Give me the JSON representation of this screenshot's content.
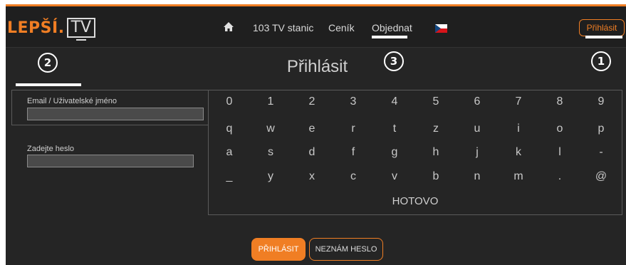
{
  "brand": {
    "logo_part1": "LEPŠÍ.",
    "logo_part2": "TV",
    "accent_color": "#f07e24"
  },
  "nav": {
    "home_icon": "home-icon",
    "items": [
      {
        "label": "103 TV stanic"
      },
      {
        "label": "Ceník"
      },
      {
        "label": "Objednat"
      }
    ],
    "language_flag": "czech-flag-icon",
    "login_label": "Přihlásit"
  },
  "page": {
    "title": "Přihlásit"
  },
  "form": {
    "email_label": "Email / Uživatelské jméno",
    "email_value": "",
    "password_label": "Zadejte heslo",
    "password_value": ""
  },
  "keyboard": {
    "rows": [
      [
        "0",
        "1",
        "2",
        "3",
        "4",
        "5",
        "6",
        "7",
        "8",
        "9"
      ],
      [
        "q",
        "w",
        "e",
        "r",
        "t",
        "z",
        "u",
        "i",
        "o",
        "p"
      ],
      [
        "a",
        "s",
        "d",
        "f",
        "g",
        "h",
        "j",
        "k",
        "l",
        "-"
      ],
      [
        "_",
        "y",
        "x",
        "c",
        "v",
        "b",
        "n",
        "m",
        ".",
        "@"
      ]
    ],
    "done_label": "HOTOVO"
  },
  "buttons": {
    "login_label": "PŘIHLÁSIT",
    "forgot_label": "NEZNÁM HESLO"
  },
  "callouts": [
    "1",
    "2",
    "3"
  ]
}
